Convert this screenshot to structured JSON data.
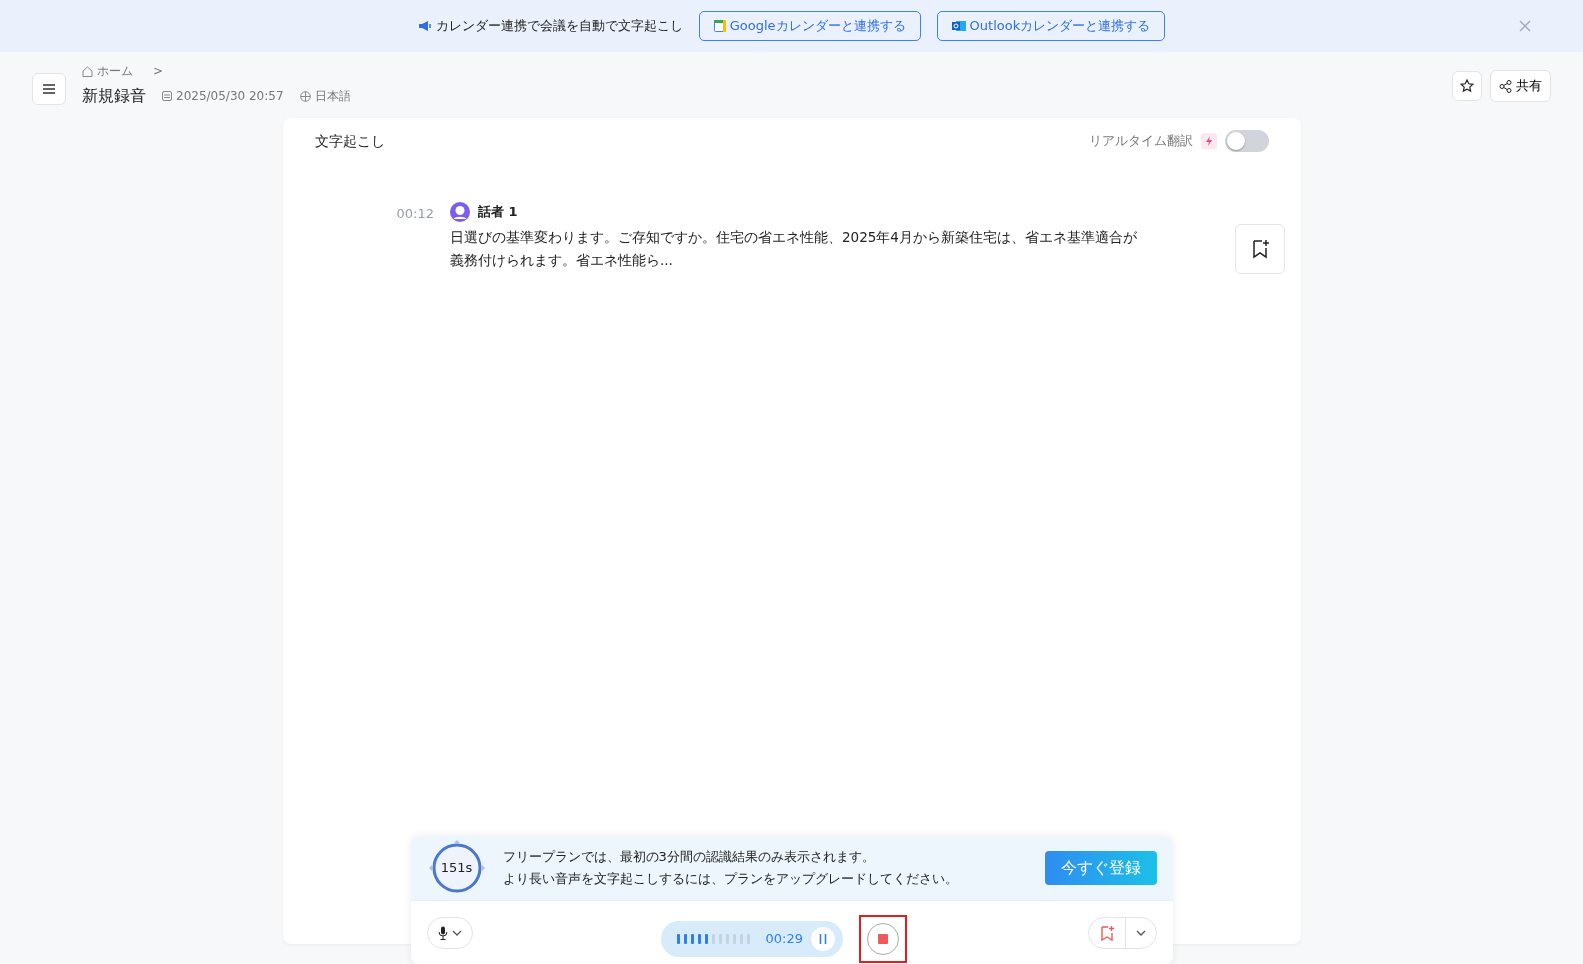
{
  "banner": {
    "text": "カレンダー連携で会議を自動で文字起こし",
    "buttons": [
      {
        "kind": "google",
        "label": "Googleカレンダーと連携する"
      },
      {
        "kind": "outlook",
        "label": "Outlookカレンダーと連携する"
      }
    ]
  },
  "breadcrumb": {
    "home": "ホーム",
    "separator": ">"
  },
  "recording": {
    "title": "新規録音",
    "date": "2025/05/30 20:57",
    "language": "日本語"
  },
  "header_actions": {
    "share": "共有"
  },
  "transcript": {
    "title": "文字起こし",
    "realtime_translation": {
      "label": "リアルタイム翻訳",
      "on": false
    },
    "segments": [
      {
        "time": "00:12",
        "speaker": "話者 1",
        "text": "日選びの基準変わります。ご存知ですか。住宅の省エネ性能、2025年4月から新築住宅は、省エネ基準適合が義務付けられます。省エネ性能ら..."
      }
    ]
  },
  "plan_notice": {
    "timer": "151s",
    "lines": [
      "フリープランでは、最初の3分間の認識結果のみ表示されます。",
      "より長い音声を文字起こしするには、プランをアップグレードしてください。"
    ],
    "button": "今すぐ登録"
  },
  "recorder": {
    "level": 0.45,
    "elapsed": "00:29"
  }
}
